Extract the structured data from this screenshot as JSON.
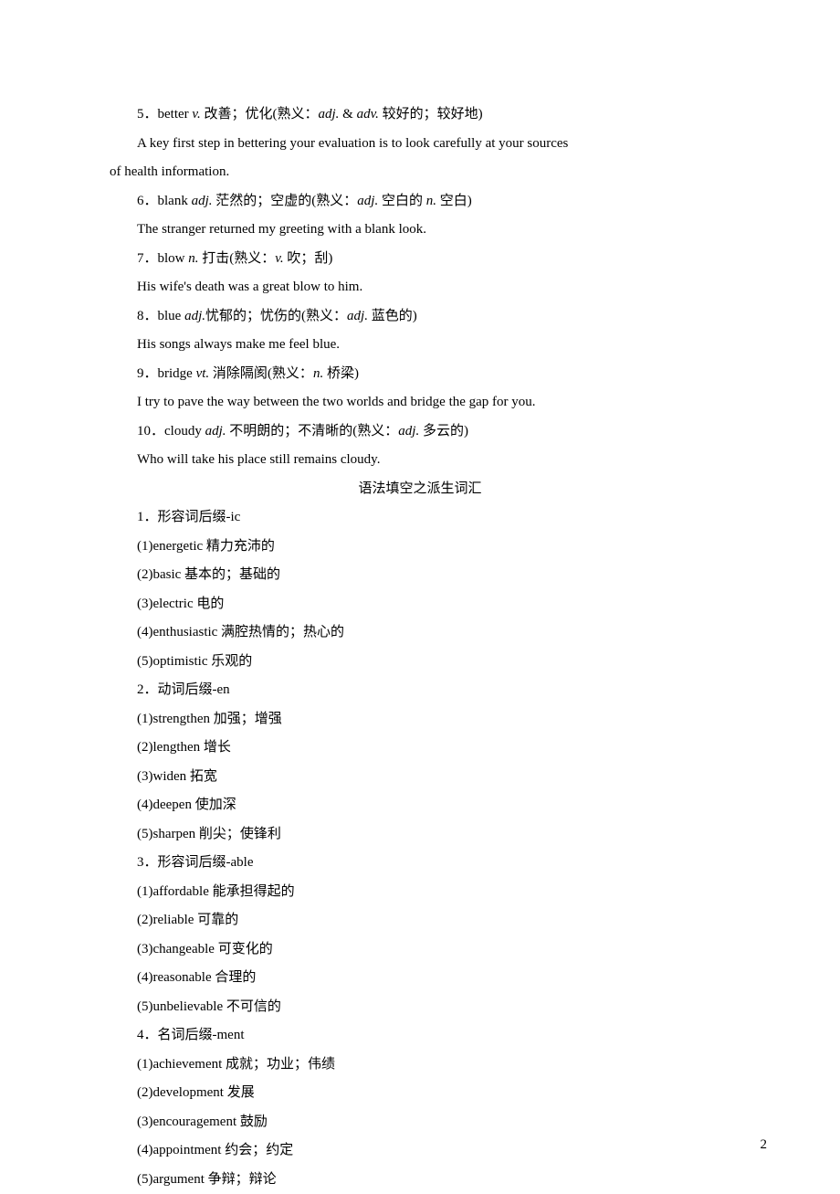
{
  "entries": [
    {
      "num": "5",
      "word": "better",
      "pos": "v.",
      "def": "改善；优化",
      "familiar": "(熟义：",
      "fpos": "adj.",
      "amp": " & ",
      "fpos2": "adv.",
      "fdef": " 较好的；较好地)"
    },
    {
      "example": "A key first step in bettering your evaluation is to look carefully at your sources of health information.",
      "cont": true
    },
    {
      "num": "6",
      "word": "blank",
      "pos": "adj.",
      "def": "茫然的；空虚的",
      "familiar": "(熟义：",
      "fpos": "adj.",
      "fdef": " 空白的 ",
      "fpos2": "n.",
      "fdef2": " 空白)"
    },
    {
      "example": "The stranger returned my greeting with a blank look."
    },
    {
      "num": "7",
      "word": "blow",
      "pos": "n.",
      "def": "打击",
      "familiar": "(熟义：",
      "fpos": "v.",
      "fdef": " 吹；刮)"
    },
    {
      "example": "His wife's death was a great blow to him."
    },
    {
      "num": "8",
      "word": "blue",
      "pos": "adj.",
      "def": "忧郁的；忧伤的",
      "familiar": "(熟义：",
      "fpos": "adj.",
      "fdef": " 蓝色的)"
    },
    {
      "example": "His songs always make me feel blue."
    },
    {
      "num": "9",
      "word": "bridge",
      "pos": "vt.",
      "def": "消除隔阂",
      "familiar": "(熟义：",
      "fpos": "n.",
      "fdef": " 桥梁)"
    },
    {
      "example": "I try to pave the way between the two worlds and bridge the gap for you."
    },
    {
      "num": "10",
      "word": "cloudy",
      "pos": "adj.",
      "def": "不明朗的；不清晰的",
      "familiar": "(熟义：",
      "fpos": "adj.",
      "fdef": " 多云的)"
    },
    {
      "example": "Who will take his place still remains cloudy."
    }
  ],
  "section_title": "语法填空之派生词汇",
  "groups": [
    {
      "heading": "1．形容词后缀-ic",
      "items": [
        "(1)energetic 精力充沛的",
        "(2)basic 基本的；基础的",
        "(3)electric 电的",
        "(4)enthusiastic 满腔热情的；热心的",
        "(5)optimistic 乐观的"
      ]
    },
    {
      "heading": "2．动词后缀-en",
      "items": [
        "(1)strengthen 加强；增强",
        "(2)lengthen 增长",
        "(3)widen 拓宽",
        "(4)deepen 使加深",
        "(5)sharpen 削尖；使锋利"
      ]
    },
    {
      "heading": "3．形容词后缀-able",
      "items": [
        "(1)affordable 能承担得起的",
        "(2)reliable 可靠的",
        "(3)changeable 可变化的",
        "(4)reasonable 合理的",
        "(5)unbelievable 不可信的"
      ]
    },
    {
      "heading": "4．名词后缀-ment",
      "items": [
        "(1)achievement 成就；功业；伟绩",
        "(2)development 发展",
        "(3)encouragement 鼓励",
        "(4)appointment 约会；约定",
        "(5)argument 争辩；辩论"
      ]
    }
  ],
  "page_number": "2"
}
